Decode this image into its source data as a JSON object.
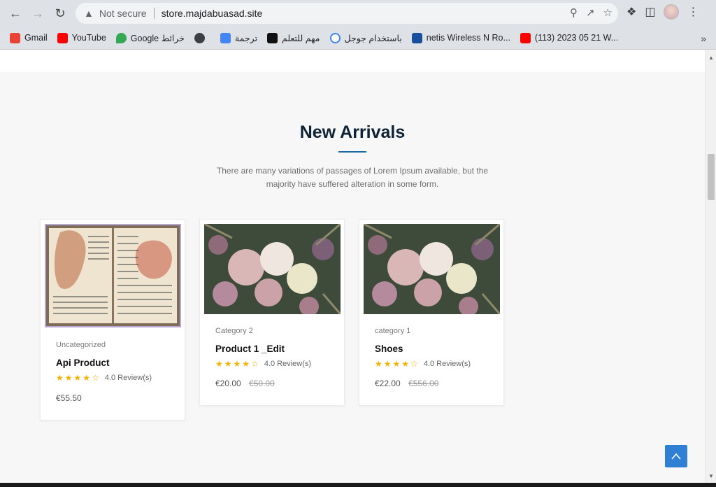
{
  "browser": {
    "security_label": "Not secure",
    "url": "store.majdabuasad.site",
    "bookmarks": [
      {
        "label": "Gmail",
        "color": "#ea4335"
      },
      {
        "label": "YouTube",
        "color": "#ff0000"
      },
      {
        "label": "Google خرائط",
        "color": "#34a853"
      },
      {
        "label": "",
        "color": "#3c4043"
      },
      {
        "label": "ترجمة",
        "color": "#4285f4"
      },
      {
        "label": "مهم للتعلم",
        "color": "#111111"
      },
      {
        "label": "باستخدام جوجل",
        "color": "#fbbc05"
      },
      {
        "label": "netis Wireless N Ro...",
        "color": "#1a4fa0"
      },
      {
        "label": "(113) 2023 05 21 W...",
        "color": "#ff0000"
      }
    ],
    "more_label": "»"
  },
  "section": {
    "title": "New Arrivals",
    "subtitle": "There are many variations of passages of Lorem Ipsum available, but the majority have suffered alteration in some form.",
    "accent_color": "#1b6aa5"
  },
  "products": [
    {
      "category": "Uncategorized",
      "name": "Api Product",
      "rating_text": "4.0 Review(s)",
      "rating": 4,
      "price": "€55.50",
      "old_price": ""
    },
    {
      "category": "Category 2",
      "name": "Product 1 _Edit",
      "rating_text": "4.0 Review(s)",
      "rating": 4,
      "price": "€20.00",
      "old_price": "€50.00"
    },
    {
      "category": "category 1",
      "name": "Shoes",
      "rating_text": "4.0 Review(s)",
      "rating": 4,
      "price": "€22.00",
      "old_price": "€556.00"
    }
  ]
}
